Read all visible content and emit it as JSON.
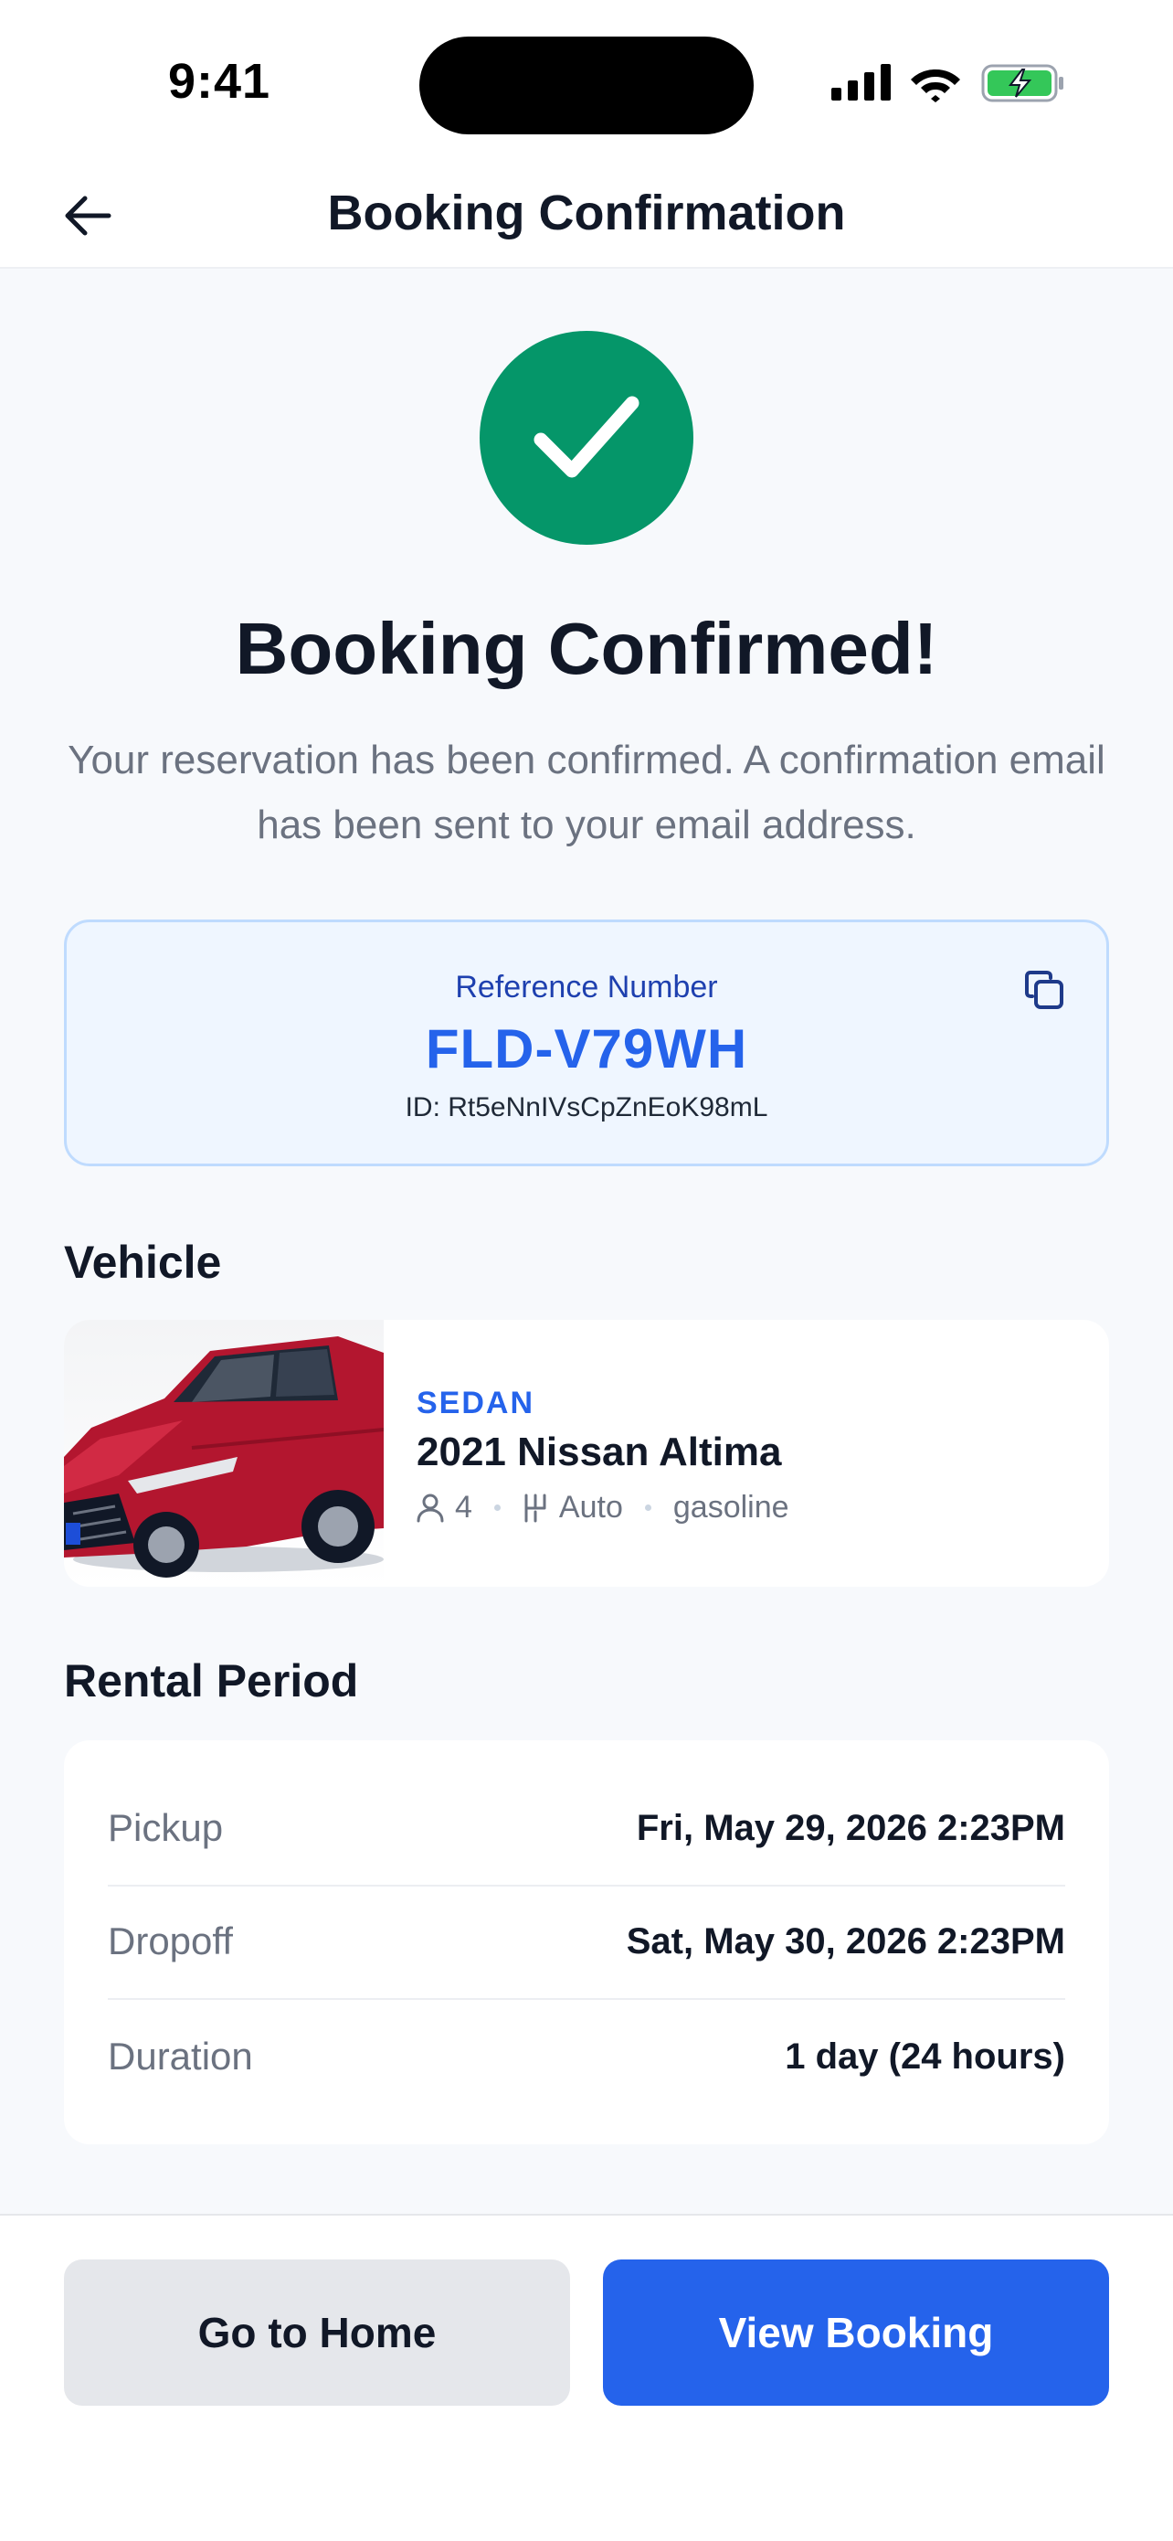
{
  "status_bar": {
    "time": "9:41"
  },
  "header": {
    "title": "Booking Confirmation",
    "back_icon": "arrow-left-icon"
  },
  "success": {
    "icon": "checkmark-icon",
    "title": "Booking Confirmed!",
    "message": "Your reservation has been confirmed. A confirmation email has been sent to your email address."
  },
  "reference": {
    "label": "Reference Number",
    "number": "FLD-V79WH",
    "id_text": "ID: Rt5eNnIVsCpZnEoK98mL",
    "copy_icon": "copy-icon"
  },
  "vehicle": {
    "heading": "Vehicle",
    "category": "SEDAN",
    "name": "2021 Nissan Altima",
    "seats": "4",
    "transmission": "Auto",
    "fuel": "gasoline"
  },
  "rental": {
    "heading": "Rental Period",
    "rows": [
      {
        "label": "Pickup",
        "value": "Fri, May 29, 2026 2:23PM"
      },
      {
        "label": "Dropoff",
        "value": "Sat, May 30, 2026 2:23PM"
      },
      {
        "label": "Duration",
        "value": "1 day (24 hours)"
      }
    ]
  },
  "actions": {
    "home_label": "Go to Home",
    "view_label": "View Booking"
  },
  "colors": {
    "accent": "#2563eb",
    "success": "#059669",
    "background": "#f7f9fc"
  }
}
